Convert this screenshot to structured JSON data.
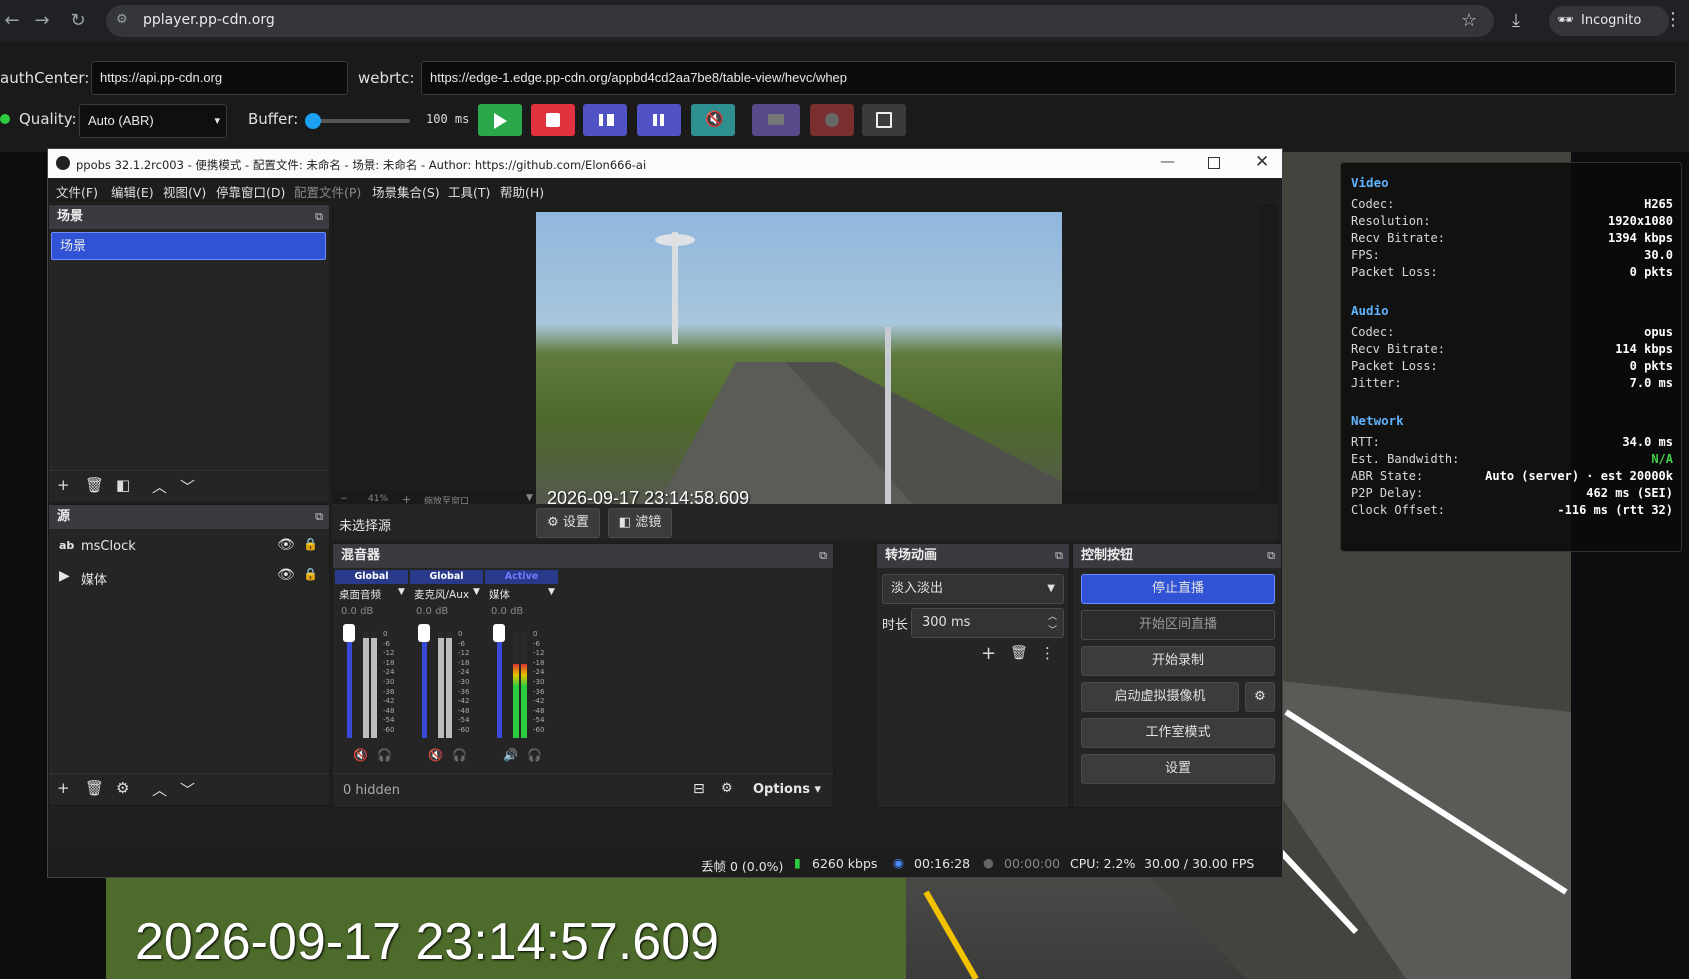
{
  "browser": {
    "url": "pplayer.pp-cdn.org",
    "incognito_label": "Incognito"
  },
  "controls": {
    "auth_label": "authCenter:",
    "auth_value": "https://api.pp-cdn.org",
    "webrtc_label": "webrtc:",
    "webrtc_value": "https://edge-1.edge.pp-cdn.org/appbd4cd2aa7be8/table-view/hevc/whep",
    "quality_label": "Quality:",
    "quality_value": "Auto (ABR)",
    "buffer_label": "Buffer:",
    "buffer_value": "100 ms",
    "buffer_level": 0.0
  },
  "colors": {
    "play": "#2aa84a",
    "stop": "#e0323f",
    "pause": "#5252c7",
    "mute": "#2d8f8f",
    "camera": "#5a4a8a",
    "record": "#7a2f2f",
    "obs_accent": "#2f53d4"
  },
  "video": {
    "big_timestamp": "2026-09-17 23:14:57.609",
    "preview_timestamp": "2026-09-17 23:14:58.609"
  },
  "stats": {
    "video_title": "Video",
    "video": [
      {
        "k": "Codec:",
        "v": "H265"
      },
      {
        "k": "Resolution:",
        "v": "1920x1080"
      },
      {
        "k": "Recv Bitrate:",
        "v": "1394 kbps"
      },
      {
        "k": "FPS:",
        "v": "30.0"
      },
      {
        "k": "Packet Loss:",
        "v": "0 pkts"
      }
    ],
    "audio_title": "Audio",
    "audio": [
      {
        "k": "Codec:",
        "v": "opus"
      },
      {
        "k": "Recv Bitrate:",
        "v": "114 kbps"
      },
      {
        "k": "Packet Loss:",
        "v": "0 pkts"
      },
      {
        "k": "Jitter:",
        "v": "7.0 ms"
      }
    ],
    "network_title": "Network",
    "network": [
      {
        "k": "RTT:",
        "v": "34.0 ms"
      },
      {
        "k": "Est. Bandwidth:",
        "v": "N/A"
      },
      {
        "k": "ABR State:",
        "v": "Auto (server) · est 20000k"
      },
      {
        "k": "P2P Delay:",
        "v": "462 ms (SEI)"
      },
      {
        "k": "Clock Offset:",
        "v": "-116 ms (rtt 32)"
      }
    ]
  },
  "obs": {
    "title": "ppobs 32.1.2rc003 - 便携模式 - 配置文件: 未命名 - 场景: 未命名 - Author: https://github.com/Elon666-ai",
    "menu": [
      "文件(F)",
      "编辑(E)",
      "视图(V)",
      "停靠窗口(D)",
      "配置文件(P)",
      "场景集合(S)",
      "工具(T)",
      "帮助(H)"
    ],
    "scenes_title": "场景",
    "scene_item": "场景",
    "sources_title": "源",
    "sources": [
      "msClock",
      "媒体"
    ],
    "zoom": "41%",
    "zoom_mode": "缩放至窗口",
    "no_source": "未选择源",
    "settings_btn": "设置",
    "filters_btn": "滤镜",
    "mixer_title": "混音器",
    "mixer_channels": [
      {
        "tag": "Global",
        "name": "桌面音频",
        "db": "0.0 dB"
      },
      {
        "tag": "Global",
        "name": "麦克风/Aux",
        "db": "0.0 dB"
      },
      {
        "tag": "Active",
        "name": "媒体",
        "db": "0.0 dB"
      }
    ],
    "meter_ticks": [
      "0",
      "-6",
      "-12",
      "-18",
      "-24",
      "-30",
      "-36",
      "-42",
      "-48",
      "-54",
      "-60"
    ],
    "hidden_count": "0 hidden",
    "options_label": "Options",
    "transitions_title": "转场动画",
    "transition_value": "淡入淡出",
    "duration_label": "时长",
    "duration_value": "300 ms",
    "controls_title": "控制按钮",
    "stop_stream": "停止直播",
    "start_interval": "开始区间直播",
    "start_record": "开始录制",
    "virtual_cam": "启动虚拟摄像机",
    "studio_mode": "工作室模式",
    "settings": "设置",
    "status_dropped": "丢帧 0 (0.0%)",
    "status_bitrate": "6260 kbps",
    "status_stream_time": "00:16:28",
    "status_rec_time": "00:00:00",
    "status_cpu": "CPU: 2.2%",
    "status_fps": "30.00 / 30.00 FPS"
  }
}
